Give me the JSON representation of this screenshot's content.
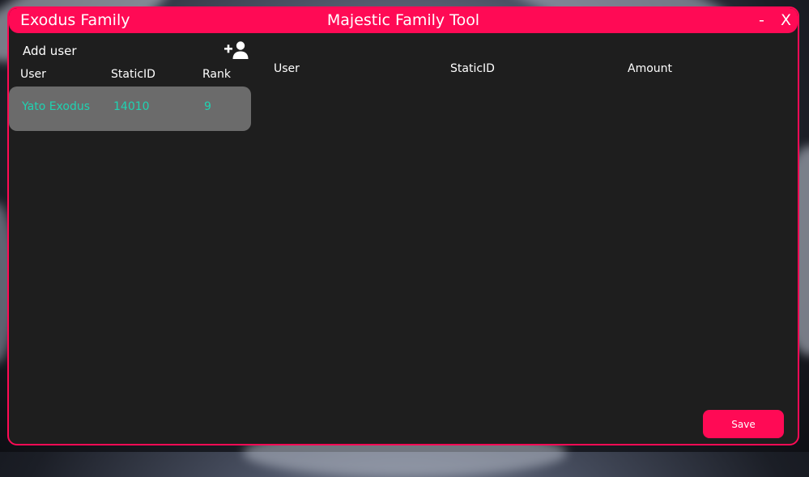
{
  "window": {
    "family_name": "Exodus Family",
    "app_title": "Majestic Family Tool",
    "minimize_label": "-",
    "close_label": "X"
  },
  "left_panel": {
    "add_user_label": "Add user",
    "add_user_icon": "person-add-icon",
    "columns": [
      "User",
      "StaticID",
      "Rank"
    ],
    "rows": [
      {
        "user": "Yato Exodus",
        "static_id": "14010",
        "rank": "9"
      }
    ]
  },
  "right_panel": {
    "columns": [
      "User",
      "StaticID",
      "Amount"
    ]
  },
  "footer": {
    "save_label": "Save"
  },
  "colors": {
    "accent": "#ff0a55",
    "panel_bg": "#1e1e1e",
    "row_bg": "#6b6b6b",
    "row_text": "#1fd3b2",
    "text": "#ffffff"
  }
}
